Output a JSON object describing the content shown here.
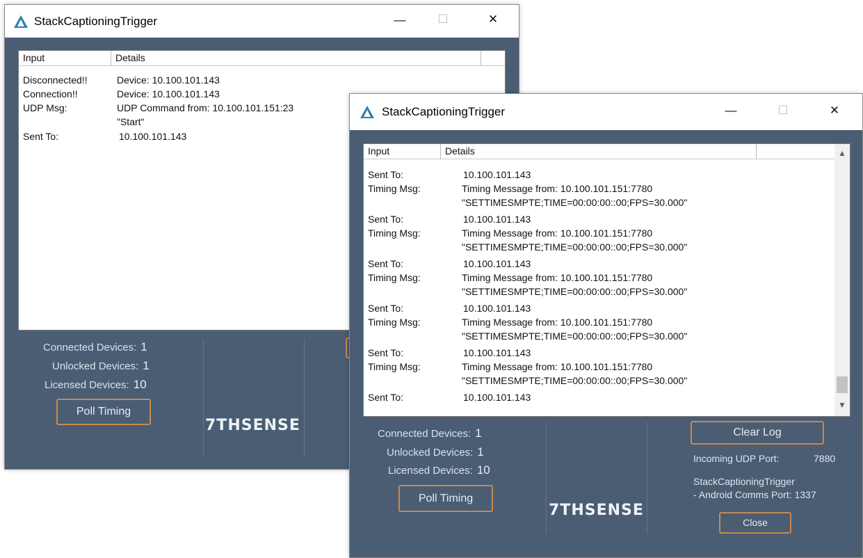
{
  "window1": {
    "title": "StackCaptioningTrigger",
    "controls": {
      "minimize": "—",
      "maximize": "☐",
      "close": "✕"
    },
    "columns": [
      "Input",
      "Details"
    ],
    "rows": [
      {
        "input": "Disconnected!!",
        "details": "Device: 10.100.101.143"
      },
      {
        "input": "Connection!!",
        "details": "Device: 10.100.101.143"
      },
      {
        "input": "UDP Msg:",
        "details": "UDP Command from: 10.100.101.151:23"
      },
      {
        "input": "",
        "details": "\"Start\""
      },
      {
        "input": "Sent To:",
        "details": "10.100.101.143"
      }
    ],
    "stats": {
      "connected_label": "Connected Devices:",
      "connected_value": "1",
      "unlocked_label": "Unlocked Devices:",
      "unlocked_value": "1",
      "licensed_label": "Licensed Devices:",
      "licensed_value": "10"
    },
    "poll_button": "Poll Timing",
    "logo": "7THSENSE"
  },
  "window2": {
    "title": "StackCaptioningTrigger",
    "controls": {
      "minimize": "—",
      "maximize": "☐",
      "close": "✕"
    },
    "columns": [
      "Input",
      "Details"
    ],
    "rows": [
      {
        "input": "Sent To:",
        "details": "10.100.101.143"
      },
      {
        "input": "Timing Msg:",
        "details": "Timing Message from: 10.100.101.151:7780"
      },
      {
        "input": "",
        "details": "\"SETTIMESMPTE;TIME=00:00:00::00;FPS=30.000\""
      },
      {
        "input": "Sent To:",
        "details": "10.100.101.143"
      },
      {
        "input": "Timing Msg:",
        "details": "Timing Message from: 10.100.101.151:7780"
      },
      {
        "input": "",
        "details": "\"SETTIMESMPTE;TIME=00:00:00::00;FPS=30.000\""
      },
      {
        "input": "Sent To:",
        "details": "10.100.101.143"
      },
      {
        "input": "Timing Msg:",
        "details": "Timing Message from: 10.100.101.151:7780"
      },
      {
        "input": "",
        "details": "\"SETTIMESMPTE;TIME=00:00:00::00;FPS=30.000\""
      },
      {
        "input": "Sent To:",
        "details": "10.100.101.143"
      },
      {
        "input": "Timing Msg:",
        "details": "Timing Message from: 10.100.101.151:7780"
      },
      {
        "input": "",
        "details": "\"SETTIMESMPTE;TIME=00:00:00::00;FPS=30.000\""
      },
      {
        "input": "Sent To:",
        "details": "10.100.101.143"
      },
      {
        "input": "Timing Msg:",
        "details": "Timing Message from: 10.100.101.151:7780"
      },
      {
        "input": "",
        "details": "\"SETTIMESMPTE;TIME=00:00:00::00;FPS=30.000\""
      },
      {
        "input": "Sent To:",
        "details": "10.100.101.143"
      }
    ],
    "stats": {
      "connected_label": "Connected Devices:",
      "connected_value": "1",
      "unlocked_label": "Unlocked Devices:",
      "unlocked_value": "1",
      "licensed_label": "Licensed Devices:",
      "licensed_value": "10"
    },
    "poll_button": "Poll Timing",
    "logo": "7THSENSE",
    "clear_log_button": "Clear Log",
    "udp_port_label": "Incoming UDP Port:",
    "udp_port_value": "7880",
    "comms_line1": "StackCaptioningTrigger",
    "comms_line2": "- Android Comms Port: 1337",
    "close_button": "Close"
  },
  "colors": {
    "window_bg": "#4a5d73",
    "button_border": "#c8894f",
    "app_icon": "#2f7fb0"
  },
  "icons": [
    "app-triangle-icon",
    "minimize-icon",
    "maximize-icon",
    "close-icon",
    "scroll-up-icon",
    "scroll-down-icon"
  ]
}
